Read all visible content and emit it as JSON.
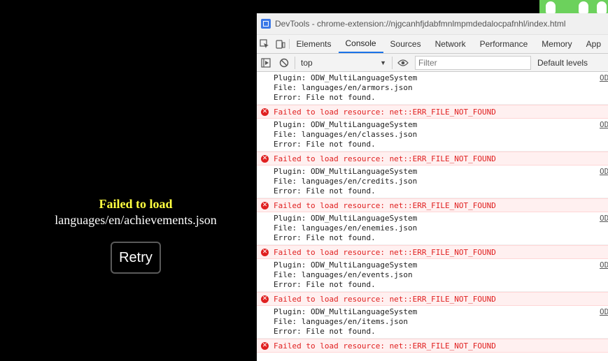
{
  "game": {
    "error_title": "Failed to load",
    "error_file": "languages/en/achievements.json",
    "retry_label": "Retry"
  },
  "devtools": {
    "window_title": "DevTools - chrome-extension://njgcanhfjdabfmnlmpmdedalocpafnhl/index.html",
    "tabs": [
      "Elements",
      "Console",
      "Sources",
      "Network",
      "Performance",
      "Memory",
      "App"
    ],
    "active_tab": "Console",
    "context": "top",
    "filter_placeholder": "Filter",
    "levels_label": "Default levels",
    "source_link": "OD",
    "error_text": "Failed to load resource: net::ERR_FILE_NOT_FOUND",
    "log_groups": [
      {
        "plugin": "Plugin: ODW_MultiLanguageSystem",
        "file": "File: languages/en/armors.json",
        "error": "Error: File not found."
      },
      {
        "plugin": "Plugin: ODW_MultiLanguageSystem",
        "file": "File: languages/en/classes.json",
        "error": "Error: File not found."
      },
      {
        "plugin": "Plugin: ODW_MultiLanguageSystem",
        "file": "File: languages/en/credits.json",
        "error": "Error: File not found."
      },
      {
        "plugin": "Plugin: ODW_MultiLanguageSystem",
        "file": "File: languages/en/enemies.json",
        "error": "Error: File not found."
      },
      {
        "plugin": "Plugin: ODW_MultiLanguageSystem",
        "file": "File: languages/en/events.json",
        "error": "Error: File not found."
      },
      {
        "plugin": "Plugin: ODW_MultiLanguageSystem",
        "file": "File: languages/en/items.json",
        "error": "Error: File not found."
      }
    ]
  },
  "colors": {
    "error_red": "#e02020",
    "error_bg": "#fff0f0",
    "title_yellow": "#ffff40",
    "accent_blue": "#1a73e8",
    "strip_green": "#6cd15c"
  }
}
